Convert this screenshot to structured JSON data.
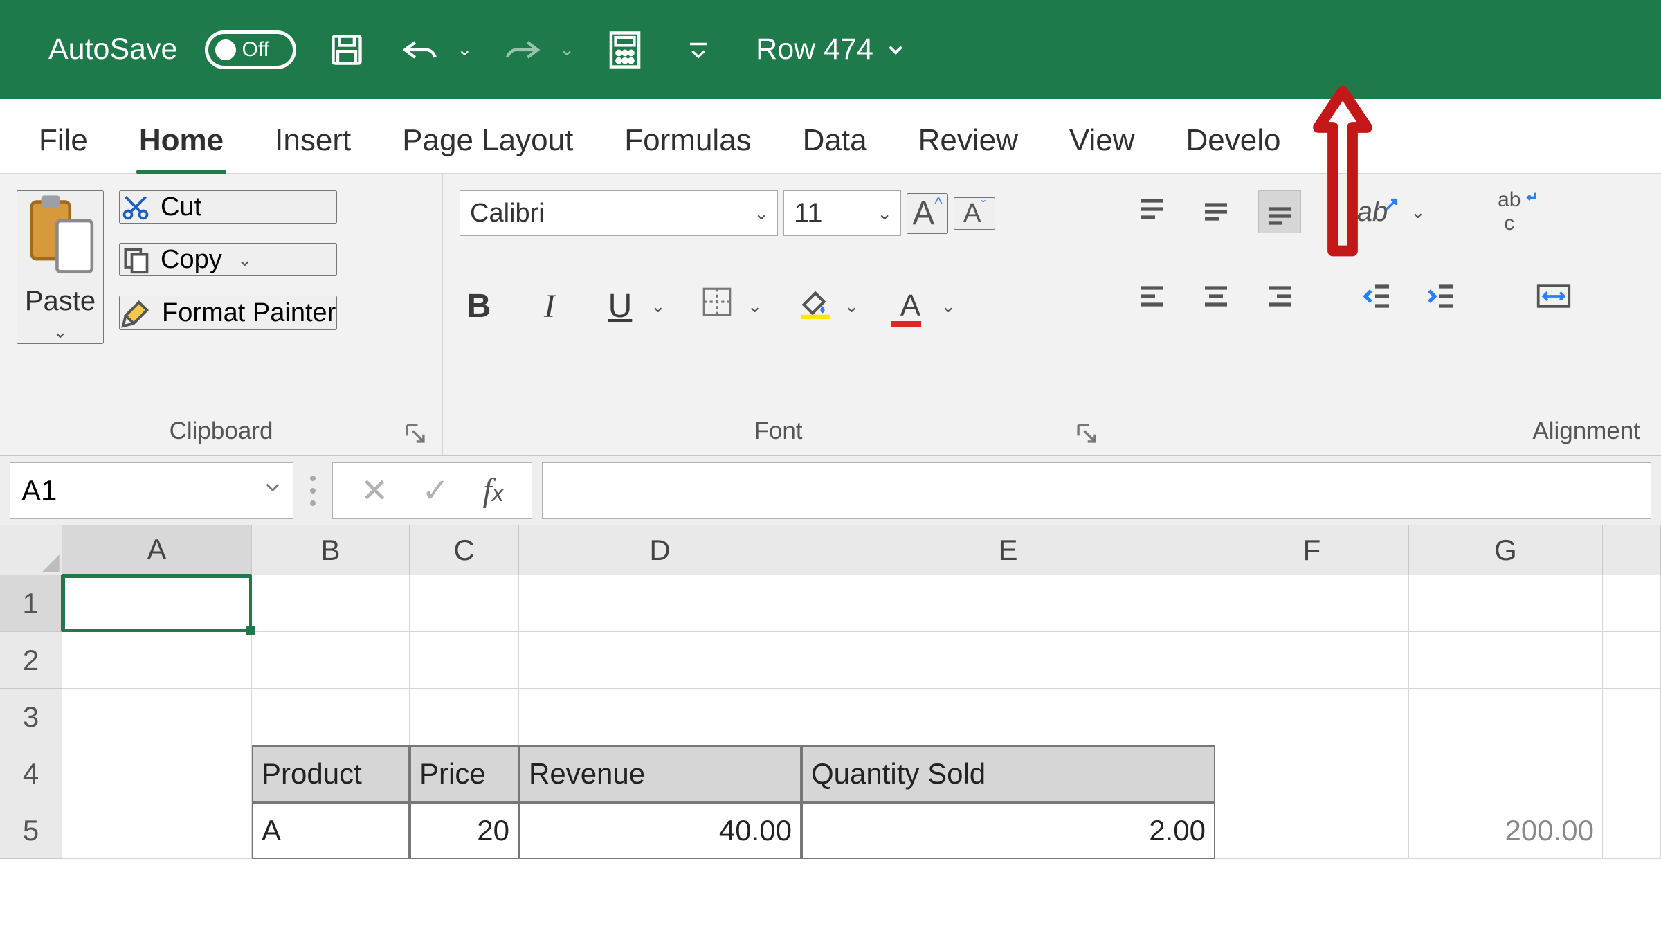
{
  "titlebar": {
    "autosave_text": "AutoSave",
    "autosave_state": "Off",
    "doc_name": "Row 474"
  },
  "tabs": [
    "File",
    "Home",
    "Insert",
    "Page Layout",
    "Formulas",
    "Data",
    "Review",
    "View",
    "Develo"
  ],
  "active_tab": "Home",
  "clipboard": {
    "paste_label": "Paste",
    "cut_label": "Cut",
    "copy_label": "Copy",
    "format_painter_label": "Format Painter",
    "group_label": "Clipboard"
  },
  "font": {
    "name": "Calibri",
    "size": "11",
    "b": "B",
    "i": "I",
    "u": "U",
    "group_label": "Font"
  },
  "align": {
    "group_label": "Alignment"
  },
  "fx": {
    "cell_ref": "A1"
  },
  "grid": {
    "cols": [
      "A",
      "B",
      "C",
      "D",
      "E",
      "F",
      "G"
    ],
    "rows": [
      "1",
      "2",
      "3",
      "4",
      "5"
    ],
    "headers": {
      "b4": "Product",
      "c4": "Price",
      "d4": "Revenue",
      "e4": "Quantity Sold"
    },
    "row5": {
      "b": "A",
      "c": "20",
      "d": "40.00",
      "e": "2.00",
      "g": "200.00"
    }
  }
}
